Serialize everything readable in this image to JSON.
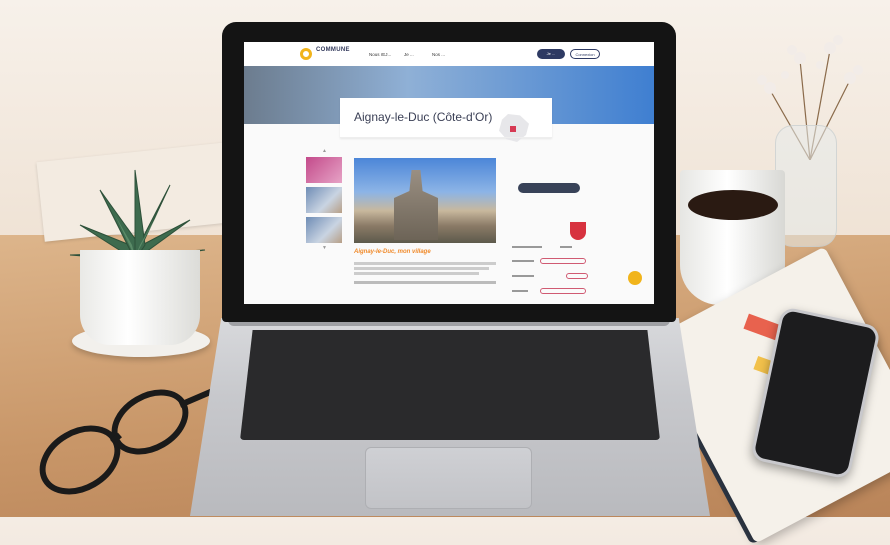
{
  "site": {
    "logo_line1": "COMMUNE",
    "logo_line2": "",
    "nav": [
      "Nous rEJ...",
      "Je ...",
      "Nos ..."
    ],
    "btn_primary": "Je ...",
    "btn_secondary": "Connexion",
    "page_title": "Aignay-le-Duc (Côte-d'Or)",
    "tabs": [
      "",
      ""
    ],
    "section_heading": "Aignay-le-Duc, mon village",
    "side_heading": "",
    "side_button": "",
    "info_heading": "",
    "accent_color": "#f1b41b",
    "primary_color": "#2e3a63",
    "pink_color": "#d05a72"
  }
}
